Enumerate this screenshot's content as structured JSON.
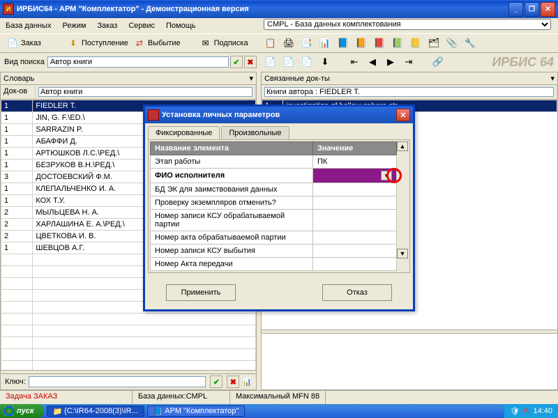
{
  "window": {
    "title": "ИРБИС64 - АРМ \"Комплектатор\" - Демонстрационная версия"
  },
  "menu": [
    "База данных",
    "Режим",
    "Заказ",
    "Сервис",
    "Помощь"
  ],
  "db_combo": "CMPL - База данных комплектования",
  "toolbar": {
    "order": "Заказ",
    "receipt": "Поступление",
    "disposal": "Выбытие",
    "subscribe": "Подписка"
  },
  "search": {
    "label": "Вид поиска",
    "value": "Автор книги"
  },
  "brand": "ИРБИС 64",
  "left": {
    "title": "Словарь",
    "col1": "Док-ов",
    "col2": "Автор книги",
    "rows": [
      {
        "n": "1",
        "v": "FIEDLER T.",
        "sel": true
      },
      {
        "n": "1",
        "v": "JIN, G. F.\\ED.\\"
      },
      {
        "n": "1",
        "v": "SARRAZIN P."
      },
      {
        "n": "1",
        "v": "АБАФФИ Д."
      },
      {
        "n": "1",
        "v": "АРТЮШКОВ Л.С.\\РЕД.\\"
      },
      {
        "n": "1",
        "v": "БЕЗРУКОВ В.Н.\\РЕД.\\"
      },
      {
        "n": "3",
        "v": "ДОСТОЕВСКИЙ Ф.М."
      },
      {
        "n": "1",
        "v": "КЛЕПАЛЬЧЕНКО И. А."
      },
      {
        "n": "1",
        "v": "КОХ Т.У."
      },
      {
        "n": "2",
        "v": "МЫЛЬЦЕВА Н. А."
      },
      {
        "n": "2",
        "v": "ХАРЛАШИНА Е. А.\\РЕД.\\"
      },
      {
        "n": "2",
        "v": "ЦВЕТКОВА И. В."
      },
      {
        "n": "1",
        "v": "ШЕВЦОВ А.Г."
      }
    ]
  },
  "right": {
    "title": "Связанные док-ты",
    "header": "Книги автора : FIEDLER T.",
    "row_no": "1",
    "row_text": "investigation of hollow sphere str"
  },
  "modal": {
    "title": "Установка личных параметров",
    "tab1": "Фиксированные",
    "tab2": "Произвольные",
    "col_name": "Название элемента",
    "col_val": "Значение",
    "params": [
      {
        "name": "Этап работы",
        "val": "ПК"
      },
      {
        "name": "ФИО исполнителя",
        "val": "",
        "hl": true
      },
      {
        "name": "БД ЭК для заимствования данных",
        "val": ""
      },
      {
        "name": "Проверку экземпляров отменить?",
        "val": ""
      },
      {
        "name": "Номер записи КСУ обрабатываемой партии",
        "val": ""
      },
      {
        "name": "Номер акта обрабатываемой партии",
        "val": ""
      },
      {
        "name": "Номер записи КСУ выбытия",
        "val": ""
      },
      {
        "name": "Номер Акта передачи",
        "val": ""
      }
    ],
    "apply": "Применить",
    "cancel": "Отказ"
  },
  "key": {
    "label": "Ключ:"
  },
  "status": {
    "task": "Задача ЗАКАЗ",
    "db": "База данных:CMPL",
    "mfn": "Максимальный MFN 88"
  },
  "taskbar": {
    "start": "пуск",
    "t1": "{C:\\IR64-2008(3)\\IR...",
    "t2": "АРМ \"Комплектатор\"",
    "time": "14:40"
  }
}
